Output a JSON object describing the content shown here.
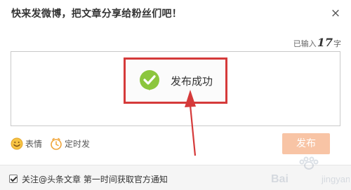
{
  "dialog": {
    "title": "快来发微博，把文章分享给粉丝们吧！",
    "close_glyph": "×"
  },
  "counter": {
    "prefix": "已输入",
    "count": "17",
    "suffix": "字"
  },
  "toast": {
    "text": "发布成功",
    "icon": "check-circle-icon"
  },
  "toolbar": {
    "emoji_label": "表情",
    "emoji_icon": "smiley-icon",
    "schedule_label": "定时发",
    "schedule_icon": "clock-icon",
    "publish_label": "发布"
  },
  "footer": {
    "follow_checked": true,
    "follow_label": "关注@头条文章 第一时间获取官方通知"
  },
  "colors": {
    "annotation_red": "#d53a3a",
    "success_green": "#8cc63e",
    "publish_disabled": "#f8c4a5",
    "icon_orange": "#f0a53a"
  }
}
